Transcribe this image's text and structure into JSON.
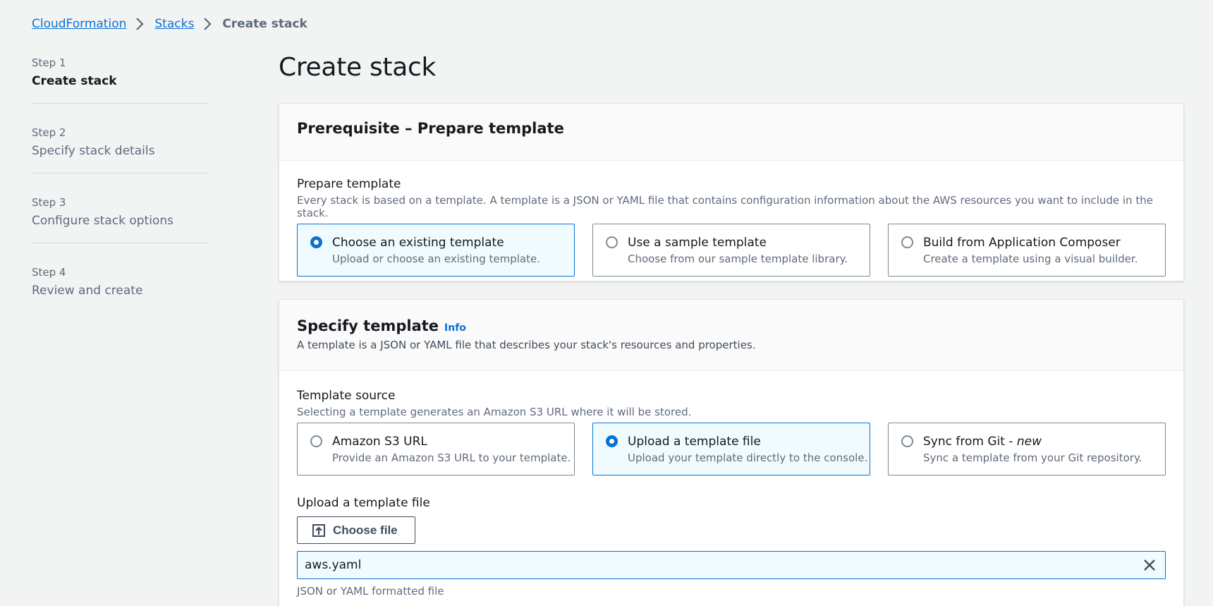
{
  "breadcrumb": {
    "items": [
      "CloudFormation",
      "Stacks"
    ],
    "current": "Create stack"
  },
  "steps": [
    {
      "number": "Step 1",
      "title": "Create stack",
      "active": true
    },
    {
      "number": "Step 2",
      "title": "Specify stack details",
      "active": false
    },
    {
      "number": "Step 3",
      "title": "Configure stack options",
      "active": false
    },
    {
      "number": "Step 4",
      "title": "Review and create",
      "active": false
    }
  ],
  "page_title": "Create stack",
  "prerequisite": {
    "title": "Prerequisite – Prepare template",
    "field_label": "Prepare template",
    "field_desc": "Every stack is based on a template. A template is a JSON or YAML file that contains configuration information about the AWS resources you want to include in the stack.",
    "options": [
      {
        "title": "Choose an existing template",
        "desc": "Upload or choose an existing template.",
        "selected": true
      },
      {
        "title": "Use a sample template",
        "desc": "Choose from our sample template library.",
        "selected": false
      },
      {
        "title": "Build from Application Composer",
        "desc": "Create a template using a visual builder.",
        "selected": false
      }
    ]
  },
  "specify": {
    "title": "Specify template",
    "info": "Info",
    "desc": "A template is a JSON or YAML file that describes your stack's resources and properties.",
    "source_label": "Template source",
    "source_desc": "Selecting a template generates an Amazon S3 URL where it will be stored.",
    "sources": [
      {
        "title": "Amazon S3 URL",
        "title_suffix": "",
        "desc": "Provide an Amazon S3 URL to your template.",
        "selected": false
      },
      {
        "title": "Upload a template file",
        "title_suffix": "",
        "desc": "Upload your template directly to the console.",
        "selected": true
      },
      {
        "title": "Sync from Git - ",
        "title_suffix": "new",
        "desc": "Sync a template from your Git repository.",
        "selected": false
      }
    ],
    "upload_label": "Upload a template file",
    "choose_file": "Choose file",
    "file_name": "aws.yaml",
    "constraint": "JSON or YAML formatted file"
  },
  "colors": {
    "accent": "#0972d3",
    "selected_bg": "#f0fbff",
    "page_bg": "#f2f3f3"
  },
  "icons": {
    "breadcrumb_separator": "chevron-right-icon",
    "upload": "upload-icon",
    "dismiss": "close-icon"
  }
}
